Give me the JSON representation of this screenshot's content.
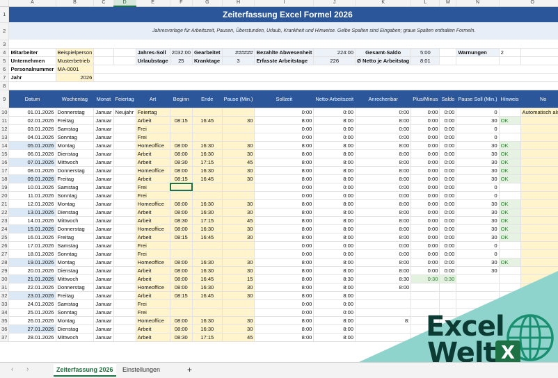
{
  "columns": [
    "A",
    "B",
    "C",
    "D",
    "E",
    "F",
    "G",
    "H",
    "I",
    "J",
    "K",
    "L",
    "M",
    "N",
    "O"
  ],
  "selected_column": "D",
  "title": "Zeiterfassung Excel Formel 2026",
  "subtitle": "Jahresvorlage für Arbeitszeit, Pausen, Überstunden, Urlaub, Krankheit und Hinweise. Gelbe Spalten sind Eingaben; graue Spalten enthalten Formeln.",
  "info": {
    "mitarbeiter_label": "Mitarbeiter",
    "mitarbeiter": "Beispielperson",
    "unternehmen_label": "Unternehmen",
    "unternehmen": "Musterbetrieb",
    "personalnummer_label": "Personalnummer",
    "personalnummer": "MA-0001",
    "jahr_label": "Jahr",
    "jahr": "2026",
    "jahres_soll_label": "Jahres-Soll",
    "jahres_soll": "2032:00",
    "urlaubstage_label": "Urlaubstage",
    "urlaubstage": "25",
    "gearbeitet_label": "Gearbeitet",
    "gearbeitet": "######",
    "kranktage_label": "Kranktage",
    "kranktage": "3",
    "bezahlte_label": "Bezahlte Abwesenheit",
    "bezahlte": "224:00",
    "erfasste_label": "Erfasste Arbeitstage",
    "erfasste": "226",
    "gesamt_saldo_label": "Gesamt-Saldo",
    "gesamt_saldo": "5:00",
    "netto_label": "Ø Netto je Arbeitstag",
    "netto": "8:01",
    "warnungen_label": "Warnungen",
    "warnungen": "2"
  },
  "headers": [
    "Datum",
    "Wochentag",
    "Monat",
    "Feiertag",
    "Art",
    "Beginn",
    "Ende",
    "Pause (Min.)",
    "Sollzeit",
    "Netto-Arbeitszeit",
    "Anrechenbar",
    "Plus/Minus",
    "Saldo",
    "Pause Soll (Min.)",
    "Hinweis",
    "No"
  ],
  "rows": [
    {
      "r": "10",
      "datum": "01.01.2026",
      "tag": "Donnerstag",
      "monat": "Januar",
      "feiertag": "Neujahr",
      "art": "Feiertag",
      "beginn": "",
      "ende": "",
      "pause": "",
      "soll": "0:00",
      "netto": "0:00",
      "anr": "0:00",
      "pm": "0:00",
      "saldo": "0:00",
      "psoll": "0",
      "hinweis": "",
      "note": "Automatisch als F"
    },
    {
      "r": "11",
      "datum": "02.01.2026",
      "tag": "Freitag",
      "monat": "Januar",
      "feiertag": "",
      "art": "Arbeit",
      "beginn": "08:15",
      "ende": "16:45",
      "pause": "30",
      "soll": "8:00",
      "netto": "8:00",
      "anr": "8:00",
      "pm": "0:00",
      "saldo": "0:00",
      "psoll": "30",
      "hinweis": "OK",
      "note": ""
    },
    {
      "r": "12",
      "datum": "03.01.2026",
      "tag": "Samstag",
      "monat": "Januar",
      "feiertag": "",
      "art": "Frei",
      "beginn": "",
      "ende": "",
      "pause": "",
      "soll": "0:00",
      "netto": "0:00",
      "anr": "0:00",
      "pm": "0:00",
      "saldo": "0:00",
      "psoll": "0",
      "hinweis": "",
      "note": ""
    },
    {
      "r": "13",
      "datum": "04.01.2026",
      "tag": "Sonntag",
      "monat": "Januar",
      "feiertag": "",
      "art": "Frei",
      "beginn": "",
      "ende": "",
      "pause": "",
      "soll": "0:00",
      "netto": "0:00",
      "anr": "0:00",
      "pm": "0:00",
      "saldo": "0:00",
      "psoll": "0",
      "hinweis": "",
      "note": ""
    },
    {
      "r": "14",
      "datum": "05.01.2026",
      "tag": "Montag",
      "monat": "Januar",
      "feiertag": "",
      "art": "Homeoffice",
      "beginn": "08:00",
      "ende": "16:30",
      "pause": "30",
      "soll": "8:00",
      "netto": "8:00",
      "anr": "8:00",
      "pm": "0:00",
      "saldo": "0:00",
      "psoll": "30",
      "hinweis": "OK",
      "note": ""
    },
    {
      "r": "15",
      "datum": "06.01.2026",
      "tag": "Dienstag",
      "monat": "Januar",
      "feiertag": "",
      "art": "Arbeit",
      "beginn": "08:00",
      "ende": "16:30",
      "pause": "30",
      "soll": "8:00",
      "netto": "8:00",
      "anr": "8:00",
      "pm": "0:00",
      "saldo": "0:00",
      "psoll": "30",
      "hinweis": "OK",
      "note": ""
    },
    {
      "r": "16",
      "datum": "07.01.2026",
      "tag": "Mittwoch",
      "monat": "Januar",
      "feiertag": "",
      "art": "Arbeit",
      "beginn": "08:30",
      "ende": "17:15",
      "pause": "45",
      "soll": "8:00",
      "netto": "8:00",
      "anr": "8:00",
      "pm": "0:00",
      "saldo": "0:00",
      "psoll": "30",
      "hinweis": "OK",
      "note": ""
    },
    {
      "r": "17",
      "datum": "08.01.2026",
      "tag": "Donnerstag",
      "monat": "Januar",
      "feiertag": "",
      "art": "Homeoffice",
      "beginn": "08:00",
      "ende": "16:30",
      "pause": "30",
      "soll": "8:00",
      "netto": "8:00",
      "anr": "8:00",
      "pm": "0:00",
      "saldo": "0:00",
      "psoll": "30",
      "hinweis": "OK",
      "note": ""
    },
    {
      "r": "18",
      "datum": "09.01.2026",
      "tag": "Freitag",
      "monat": "Januar",
      "feiertag": "",
      "art": "Arbeit",
      "beginn": "08:15",
      "ende": "16:45",
      "pause": "30",
      "soll": "8:00",
      "netto": "8:00",
      "anr": "8:00",
      "pm": "0:00",
      "saldo": "0:00",
      "psoll": "30",
      "hinweis": "OK",
      "note": ""
    },
    {
      "r": "19",
      "datum": "10.01.2026",
      "tag": "Samstag",
      "monat": "Januar",
      "feiertag": "",
      "art": "Frei",
      "beginn": "",
      "ende": "",
      "pause": "",
      "soll": "0:00",
      "netto": "0:00",
      "anr": "0:00",
      "pm": "0:00",
      "saldo": "0:00",
      "psoll": "0",
      "hinweis": "",
      "note": ""
    },
    {
      "r": "20",
      "datum": "11.01.2026",
      "tag": "Sonntag",
      "monat": "Januar",
      "feiertag": "",
      "art": "Frei",
      "beginn": "",
      "ende": "",
      "pause": "",
      "soll": "0:00",
      "netto": "0:00",
      "anr": "0:00",
      "pm": "0:00",
      "saldo": "0:00",
      "psoll": "0",
      "hinweis": "",
      "note": ""
    },
    {
      "r": "21",
      "datum": "12.01.2026",
      "tag": "Montag",
      "monat": "Januar",
      "feiertag": "",
      "art": "Homeoffice",
      "beginn": "08:00",
      "ende": "16:30",
      "pause": "30",
      "soll": "8:00",
      "netto": "8:00",
      "anr": "8:00",
      "pm": "0:00",
      "saldo": "0:00",
      "psoll": "30",
      "hinweis": "OK",
      "note": ""
    },
    {
      "r": "22",
      "datum": "13.01.2026",
      "tag": "Dienstag",
      "monat": "Januar",
      "feiertag": "",
      "art": "Arbeit",
      "beginn": "08:00",
      "ende": "16:30",
      "pause": "30",
      "soll": "8:00",
      "netto": "8:00",
      "anr": "8:00",
      "pm": "0:00",
      "saldo": "0:00",
      "psoll": "30",
      "hinweis": "OK",
      "note": ""
    },
    {
      "r": "23",
      "datum": "14.01.2026",
      "tag": "Mittwoch",
      "monat": "Januar",
      "feiertag": "",
      "art": "Arbeit",
      "beginn": "08:30",
      "ende": "17:15",
      "pause": "45",
      "soll": "8:00",
      "netto": "8:00",
      "anr": "8:00",
      "pm": "0:00",
      "saldo": "0:00",
      "psoll": "30",
      "hinweis": "OK",
      "note": ""
    },
    {
      "r": "24",
      "datum": "15.01.2026",
      "tag": "Donnerstag",
      "monat": "Januar",
      "feiertag": "",
      "art": "Homeoffice",
      "beginn": "08:00",
      "ende": "16:30",
      "pause": "30",
      "soll": "8:00",
      "netto": "8:00",
      "anr": "8:00",
      "pm": "0:00",
      "saldo": "0:00",
      "psoll": "30",
      "hinweis": "OK",
      "note": ""
    },
    {
      "r": "25",
      "datum": "16.01.2026",
      "tag": "Freitag",
      "monat": "Januar",
      "feiertag": "",
      "art": "Arbeit",
      "beginn": "08:15",
      "ende": "16:45",
      "pause": "30",
      "soll": "8:00",
      "netto": "8:00",
      "anr": "8:00",
      "pm": "0:00",
      "saldo": "0:00",
      "psoll": "30",
      "hinweis": "OK",
      "note": ""
    },
    {
      "r": "26",
      "datum": "17.01.2026",
      "tag": "Samstag",
      "monat": "Januar",
      "feiertag": "",
      "art": "Frei",
      "beginn": "",
      "ende": "",
      "pause": "",
      "soll": "0:00",
      "netto": "0:00",
      "anr": "0:00",
      "pm": "0:00",
      "saldo": "0:00",
      "psoll": "0",
      "hinweis": "",
      "note": ""
    },
    {
      "r": "27",
      "datum": "18.01.2026",
      "tag": "Sonntag",
      "monat": "Januar",
      "feiertag": "",
      "art": "Frei",
      "beginn": "",
      "ende": "",
      "pause": "",
      "soll": "0:00",
      "netto": "0:00",
      "anr": "0:00",
      "pm": "0:00",
      "saldo": "0:00",
      "psoll": "0",
      "hinweis": "",
      "note": ""
    },
    {
      "r": "28",
      "datum": "19.01.2026",
      "tag": "Montag",
      "monat": "Januar",
      "feiertag": "",
      "art": "Homeoffice",
      "beginn": "08:00",
      "ende": "16:30",
      "pause": "30",
      "soll": "8:00",
      "netto": "8:00",
      "anr": "8:00",
      "pm": "0:00",
      "saldo": "0:00",
      "psoll": "30",
      "hinweis": "OK",
      "note": ""
    },
    {
      "r": "29",
      "datum": "20.01.2026",
      "tag": "Dienstag",
      "monat": "Januar",
      "feiertag": "",
      "art": "Arbeit",
      "beginn": "08:00",
      "ende": "16:30",
      "pause": "30",
      "soll": "8:00",
      "netto": "8:00",
      "anr": "8:00",
      "pm": "0:00",
      "saldo": "0:00",
      "psoll": "30",
      "hinweis": "",
      "note": ""
    },
    {
      "r": "30",
      "datum": "21.01.2026",
      "tag": "Mittwoch",
      "monat": "Januar",
      "feiertag": "",
      "art": "Arbeit",
      "beginn": "08:00",
      "ende": "16:45",
      "pause": "15",
      "soll": "8:00",
      "netto": "8:30",
      "anr": "8:30",
      "pm": "0:30",
      "saldo": "0:30",
      "psoll": "",
      "hinweis": "",
      "note": ""
    },
    {
      "r": "31",
      "datum": "22.01.2026",
      "tag": "Donnerstag",
      "monat": "Januar",
      "feiertag": "",
      "art": "Homeoffice",
      "beginn": "08:00",
      "ende": "16:30",
      "pause": "30",
      "soll": "8:00",
      "netto": "8:00",
      "anr": "8:00",
      "pm": "",
      "saldo": "",
      "psoll": "",
      "hinweis": "",
      "note": ""
    },
    {
      "r": "32",
      "datum": "23.01.2026",
      "tag": "Freitag",
      "monat": "Januar",
      "feiertag": "",
      "art": "Arbeit",
      "beginn": "08:15",
      "ende": "16:45",
      "pause": "30",
      "soll": "8:00",
      "netto": "8:00",
      "anr": "",
      "pm": "",
      "saldo": "",
      "psoll": "",
      "hinweis": "",
      "note": ""
    },
    {
      "r": "33",
      "datum": "24.01.2026",
      "tag": "Samstag",
      "monat": "Januar",
      "feiertag": "",
      "art": "Frei",
      "beginn": "",
      "ende": "",
      "pause": "",
      "soll": "0:00",
      "netto": "0:00",
      "anr": "",
      "pm": "",
      "saldo": "",
      "psoll": "",
      "hinweis": "",
      "note": ""
    },
    {
      "r": "34",
      "datum": "25.01.2026",
      "tag": "Sonntag",
      "monat": "Januar",
      "feiertag": "",
      "art": "Frei",
      "beginn": "",
      "ende": "",
      "pause": "",
      "soll": "0:00",
      "netto": "0:00",
      "anr": "",
      "pm": "",
      "saldo": "",
      "psoll": "",
      "hinweis": "",
      "note": ""
    },
    {
      "r": "35",
      "datum": "26.01.2026",
      "tag": "Montag",
      "monat": "Januar",
      "feiertag": "",
      "art": "Homeoffice",
      "beginn": "08:00",
      "ende": "16:30",
      "pause": "30",
      "soll": "8:00",
      "netto": "8:00",
      "anr": "8:",
      "pm": "",
      "saldo": "",
      "psoll": "",
      "hinweis": "",
      "note": ""
    },
    {
      "r": "36",
      "datum": "27.01.2026",
      "tag": "Dienstag",
      "monat": "Januar",
      "feiertag": "",
      "art": "Arbeit",
      "beginn": "08:00",
      "ende": "16:30",
      "pause": "30",
      "soll": "8:00",
      "netto": "8:00",
      "anr": "",
      "pm": "",
      "saldo": "",
      "psoll": "",
      "hinweis": "",
      "note": ""
    },
    {
      "r": "37",
      "datum": "28.01.2026",
      "tag": "Mittwoch",
      "monat": "Januar",
      "feiertag": "",
      "art": "Arbeit",
      "beginn": "08:30",
      "ende": "17:15",
      "pause": "45",
      "soll": "8:00",
      "netto": "8:00",
      "anr": "",
      "pm": "",
      "saldo": "",
      "psoll": "",
      "hinweis": "",
      "note": ""
    }
  ],
  "highlighted_dates": [
    "05.01.2026",
    "07.01.2026",
    "09.01.2026",
    "13.01.2026",
    "15.01.2026",
    "19.01.2026",
    "21.01.2026",
    "23.01.2026",
    "27.01.2026"
  ],
  "tabs": [
    "Zeiterfassung 2026",
    "Einstellungen"
  ],
  "add_tab": "+",
  "nav_prev": "‹",
  "nav_next": "›",
  "logo": {
    "line1": "Excel",
    "line2": "Welt",
    "badge": "X"
  },
  "colors": {
    "header": "#2b579a",
    "input": "#fff4cc",
    "accent": "#1e7145",
    "teal": "#8fd4cc"
  }
}
